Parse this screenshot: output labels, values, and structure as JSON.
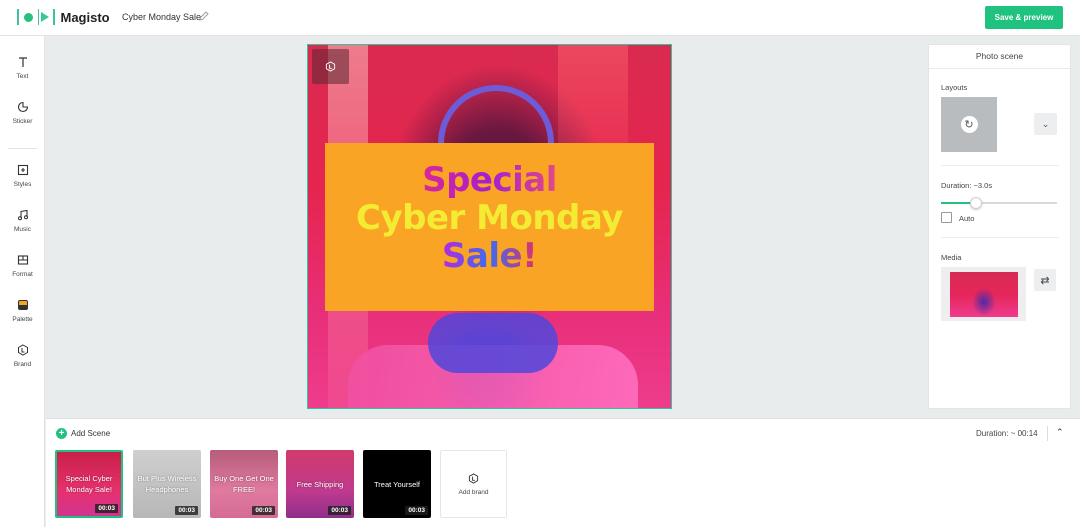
{
  "app": {
    "brand": "Magisto",
    "project_title": "Cyber Monday Sale",
    "save_label": "Save & preview",
    "accent": "#20c280"
  },
  "sidebar": {
    "items": [
      {
        "label": "Text",
        "icon": "text-icon"
      },
      {
        "label": "Sticker",
        "icon": "sticker-icon"
      },
      {
        "label": "Styles",
        "icon": "styles-icon"
      },
      {
        "label": "Music",
        "icon": "music-icon"
      },
      {
        "label": "Format",
        "icon": "format-icon"
      },
      {
        "label": "Palette",
        "icon": "palette-icon"
      },
      {
        "label": "Brand",
        "icon": "brand-icon"
      }
    ]
  },
  "canvas": {
    "line1": "Special",
    "line2": "Cyber Monday",
    "line3": "Sale!"
  },
  "panel": {
    "title": "Photo scene",
    "layouts_label": "Layouts",
    "duration_label": "Duration: ~3.0s",
    "duration_fraction": 0.3,
    "auto_label": "Auto",
    "auto_checked": false,
    "media_label": "Media"
  },
  "timeline": {
    "add_scene": "Add Scene",
    "duration": "Duration: ~ 00:14",
    "add_brand": "Add brand",
    "scenes": [
      {
        "text": "Special Cyber Monday Sale!",
        "time": "00:03",
        "active": true
      },
      {
        "text": "But Plus Wireless Headphones",
        "time": "00:03",
        "active": false
      },
      {
        "text": "Buy One Get One FREE!",
        "time": "00:03",
        "active": false
      },
      {
        "text": "Free Shipping",
        "time": "00:03",
        "active": false
      },
      {
        "text": "Treat Yourself",
        "time": "00:03",
        "active": false
      }
    ]
  }
}
